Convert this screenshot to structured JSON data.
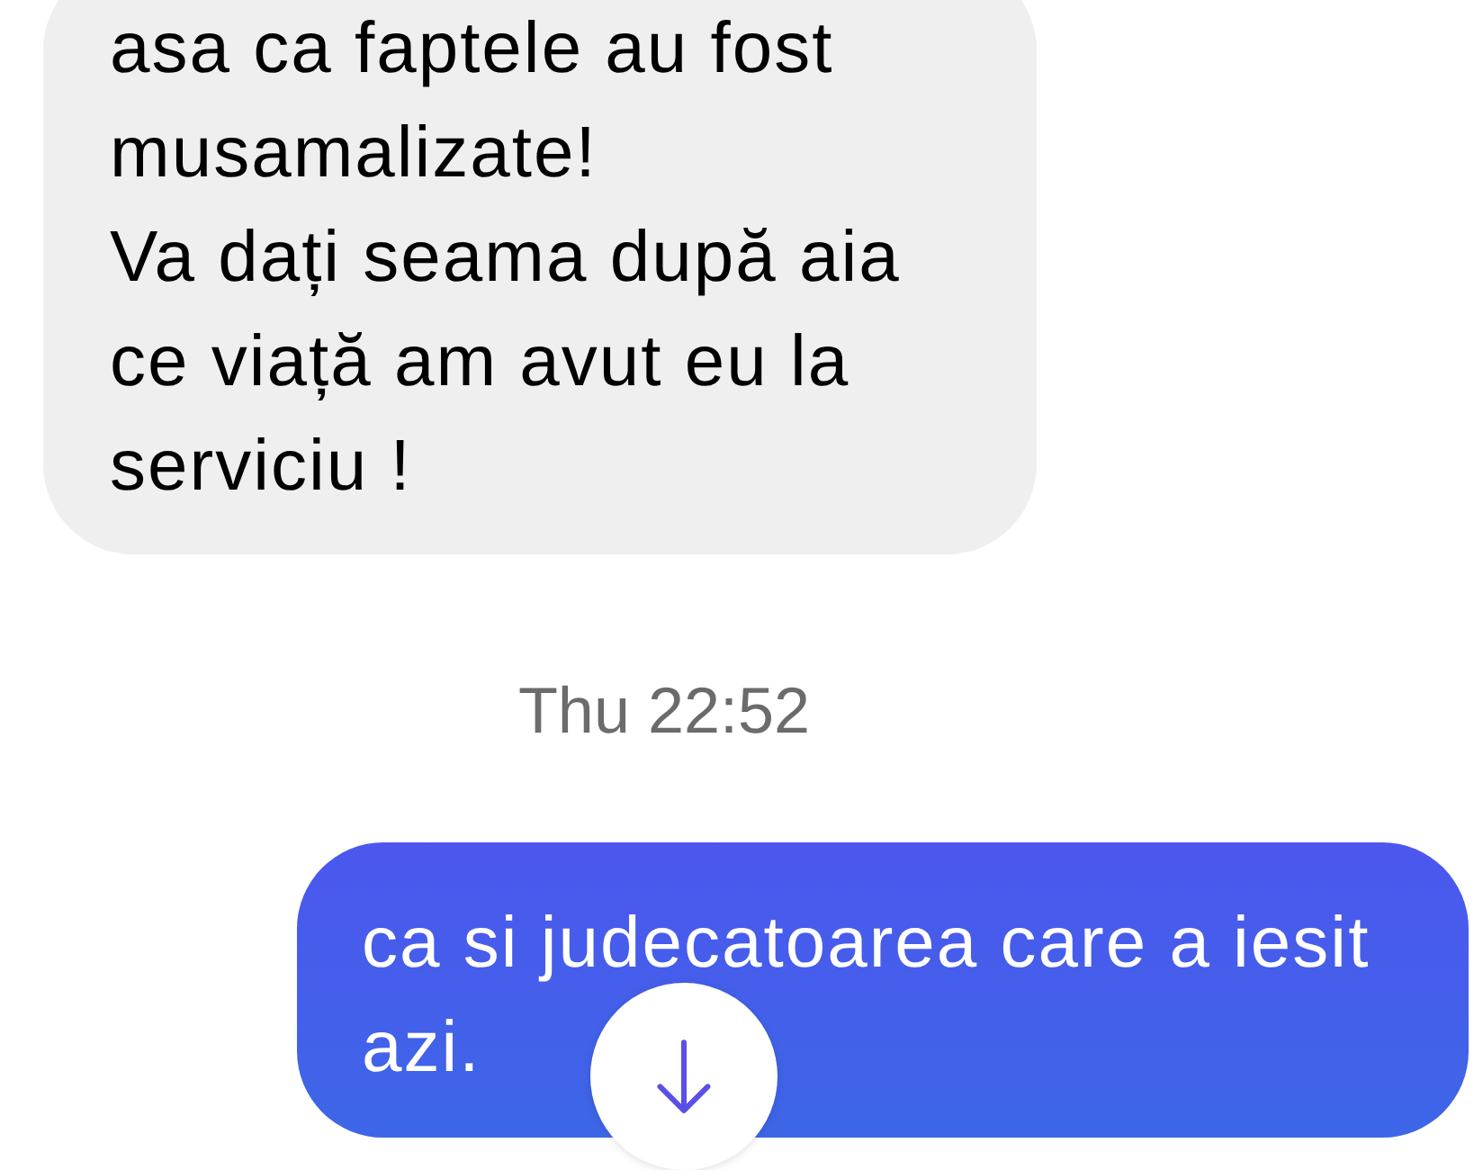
{
  "messages": [
    {
      "kind": "received",
      "text": "asa ca faptele au fost\nmusamalizate!\nVa dați seama după aia\nce viață am avut eu la\nserviciu !"
    },
    {
      "kind": "timestamp",
      "text": "Thu 22:52"
    },
    {
      "kind": "sent",
      "text": "ca si judecatoarea care a iesit\nazi."
    }
  ]
}
